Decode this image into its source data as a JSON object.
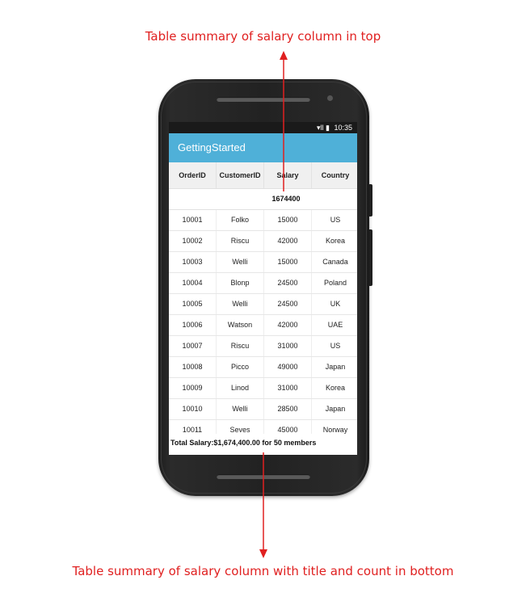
{
  "annotations": {
    "top": "Table summary of salary column in top",
    "bottom": "Table summary of salary column with title and count in bottom",
    "color": "#e02020"
  },
  "statusbar": {
    "icons": "▾ll ▮",
    "time": "10:35"
  },
  "appbar": {
    "title": "GettingStarted",
    "color": "#4fb0d8"
  },
  "grid": {
    "columns": [
      "OrderID",
      "CustomerID",
      "Salary",
      "Country"
    ],
    "top_summary": {
      "salary": "1674400"
    },
    "rows": [
      [
        "10001",
        "Folko",
        "15000",
        "US"
      ],
      [
        "10002",
        "Riscu",
        "42000",
        "Korea"
      ],
      [
        "10003",
        "Welli",
        "15000",
        "Canada"
      ],
      [
        "10004",
        "Blonp",
        "24500",
        "Poland"
      ],
      [
        "10005",
        "Welli",
        "24500",
        "UK"
      ],
      [
        "10006",
        "Watson",
        "42000",
        "UAE"
      ],
      [
        "10007",
        "Riscu",
        "31000",
        "US"
      ],
      [
        "10008",
        "Picco",
        "49000",
        "Japan"
      ],
      [
        "10009",
        "Linod",
        "31000",
        "Korea"
      ],
      [
        "10010",
        "Welli",
        "28500",
        "Japan"
      ],
      [
        "10011",
        "Seves",
        "45000",
        "Norway"
      ]
    ],
    "bottom_summary": "Total Salary:$1,674,400.00 for 50 members"
  }
}
